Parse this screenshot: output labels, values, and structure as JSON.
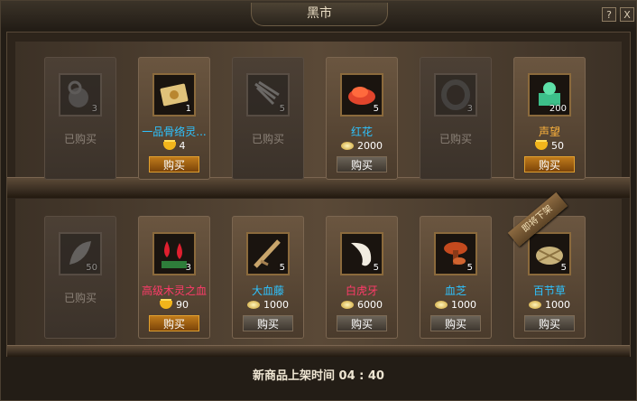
{
  "window": {
    "title": "黑市",
    "help_label": "?",
    "close_label": "X"
  },
  "footer": {
    "label": "新商品上架时间",
    "time": "04 : 40"
  },
  "ribbon": {
    "label": "即将下架"
  },
  "colors": {
    "gold_button": "#c07b1b",
    "name_blue": "#2ec3ff",
    "name_red": "#ff3b69",
    "name_orange": "#ffb43c"
  },
  "row1": [
    {
      "sold": true,
      "qty": "3",
      "sold_label": "已购买",
      "icon": "sack-icon"
    },
    {
      "sold": false,
      "qty": "1",
      "name": "一品骨络灵...",
      "price": "4",
      "currency": "ingot",
      "buy_label": "购买",
      "icon": "scroll-icon"
    },
    {
      "sold": true,
      "qty": "5",
      "sold_label": "已购买",
      "icon": "root-icon"
    },
    {
      "sold": false,
      "qty": "5",
      "name": "红花",
      "price": "2000",
      "currency": "coin",
      "buy_label": "购买",
      "icon": "red-flower-icon"
    },
    {
      "sold": true,
      "qty": "3",
      "sold_label": "已购买",
      "icon": "ring-icon"
    },
    {
      "sold": false,
      "qty": "200",
      "name": "声望",
      "price": "50",
      "currency": "ingot",
      "buy_label": "购买",
      "icon": "jade-seal-icon"
    }
  ],
  "row2": [
    {
      "sold": true,
      "qty": "50",
      "sold_label": "已购买",
      "icon": "leaf-icon"
    },
    {
      "sold": false,
      "qty": "3",
      "name": "高级木灵之血",
      "price": "90",
      "currency": "ingot",
      "buy_label": "购买",
      "icon": "blood-drops-icon"
    },
    {
      "sold": false,
      "qty": "5",
      "name": "大血藤",
      "price": "1000",
      "currency": "coin",
      "buy_label": "购买",
      "icon": "vine-icon"
    },
    {
      "sold": false,
      "qty": "5",
      "name": "白虎牙",
      "price": "6000",
      "currency": "coin",
      "buy_label": "购买",
      "icon": "tiger-fang-icon"
    },
    {
      "sold": false,
      "qty": "5",
      "name": "血芝",
      "price": "1000",
      "currency": "coin",
      "buy_label": "购买",
      "icon": "mushroom-icon"
    },
    {
      "sold": false,
      "qty": "5",
      "name": "百节草",
      "price": "1000",
      "currency": "coin",
      "buy_label": "购买",
      "icon": "grass-icon"
    }
  ]
}
